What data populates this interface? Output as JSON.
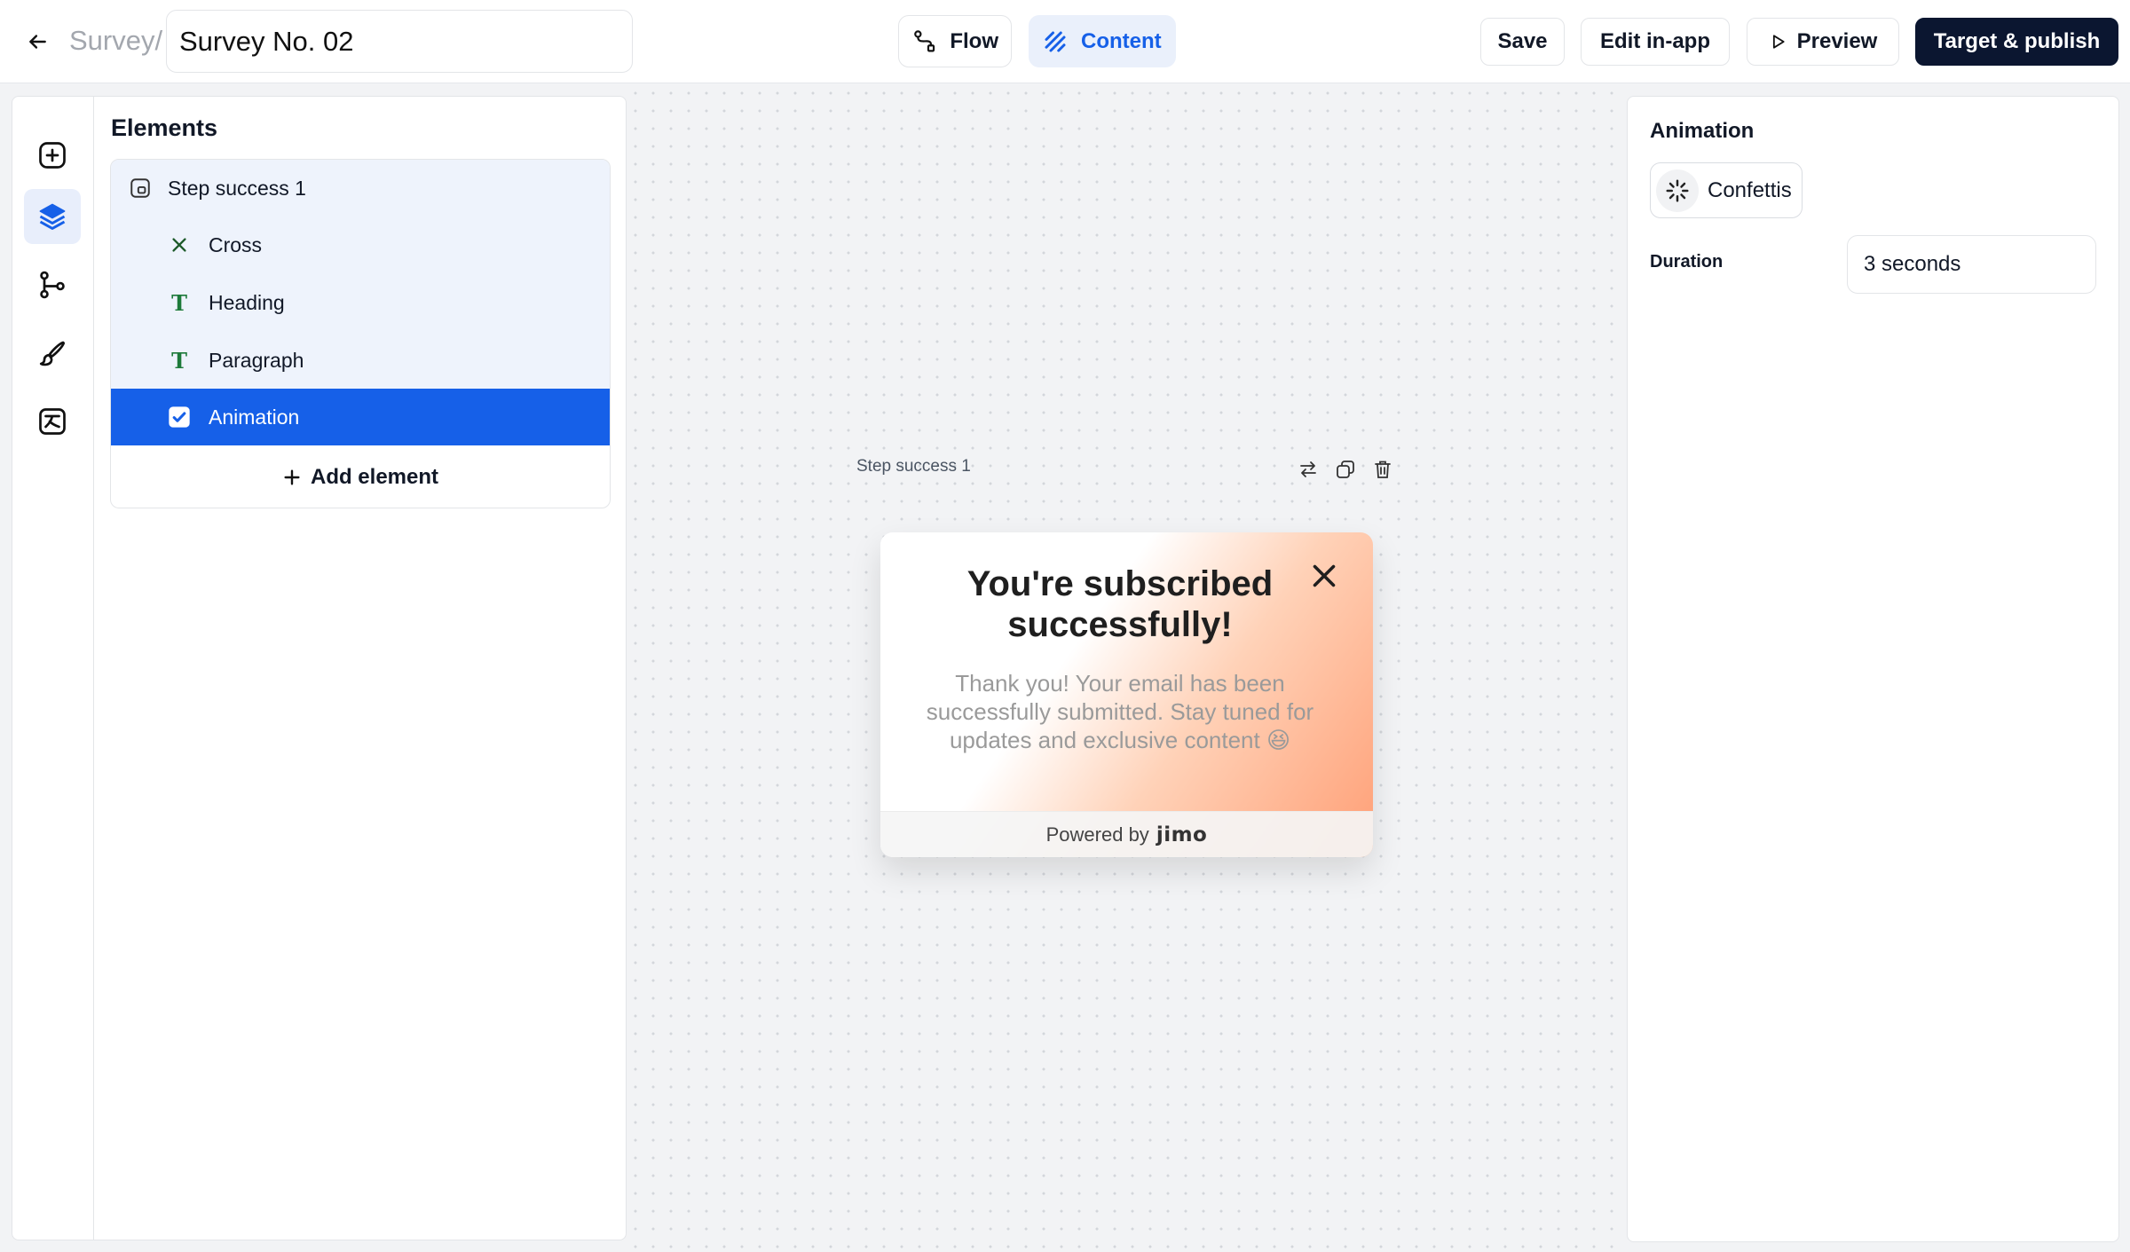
{
  "header": {
    "breadcrumb": "Survey/",
    "title_value": "Survey No. 02",
    "modes": {
      "flow_label": "Flow",
      "content_label": "Content",
      "active": "Content"
    },
    "actions": {
      "save_label": "Save",
      "edit_label": "Edit in-app",
      "preview_label": "Preview",
      "publish_label": "Target & publish"
    }
  },
  "rail": {
    "icons": [
      "plus-square-icon",
      "layers-icon",
      "branch-icon",
      "brush-icon",
      "translate-icon"
    ],
    "active": "layers-icon"
  },
  "elements": {
    "title": "Elements",
    "step": {
      "label": "Step success 1",
      "icon": "step-icon"
    },
    "children": [
      {
        "label": "Cross",
        "icon": "cross-icon"
      },
      {
        "label": "Heading",
        "icon": "text-icon"
      },
      {
        "label": "Paragraph",
        "icon": "text-icon"
      },
      {
        "label": "Animation",
        "icon": "checkbox-icon",
        "selected": true
      }
    ],
    "add_label": "Add element"
  },
  "canvas": {
    "step_label": "Step success 1",
    "tools": [
      "swap-icon",
      "duplicate-icon",
      "trash-icon"
    ],
    "card": {
      "heading": "You're subscribed successfully!",
      "paragraph": "Thank you! Your email has been successfully submitted. Stay tuned for updates and exclusive content 😆",
      "footer_prefix": "Powered by",
      "footer_brand": "jimo",
      "gradient": [
        "#ffffff",
        "#ffd2b8",
        "#ff9f76"
      ]
    }
  },
  "properties": {
    "title": "Animation",
    "animation_value": "Confettis",
    "duration_label": "Duration",
    "duration_value": "3 seconds"
  },
  "colors": {
    "accent": "#1660e8",
    "primary_dark": "#0b1630",
    "selected_row": "#1660e8",
    "group_bg": "#eef3fc"
  }
}
